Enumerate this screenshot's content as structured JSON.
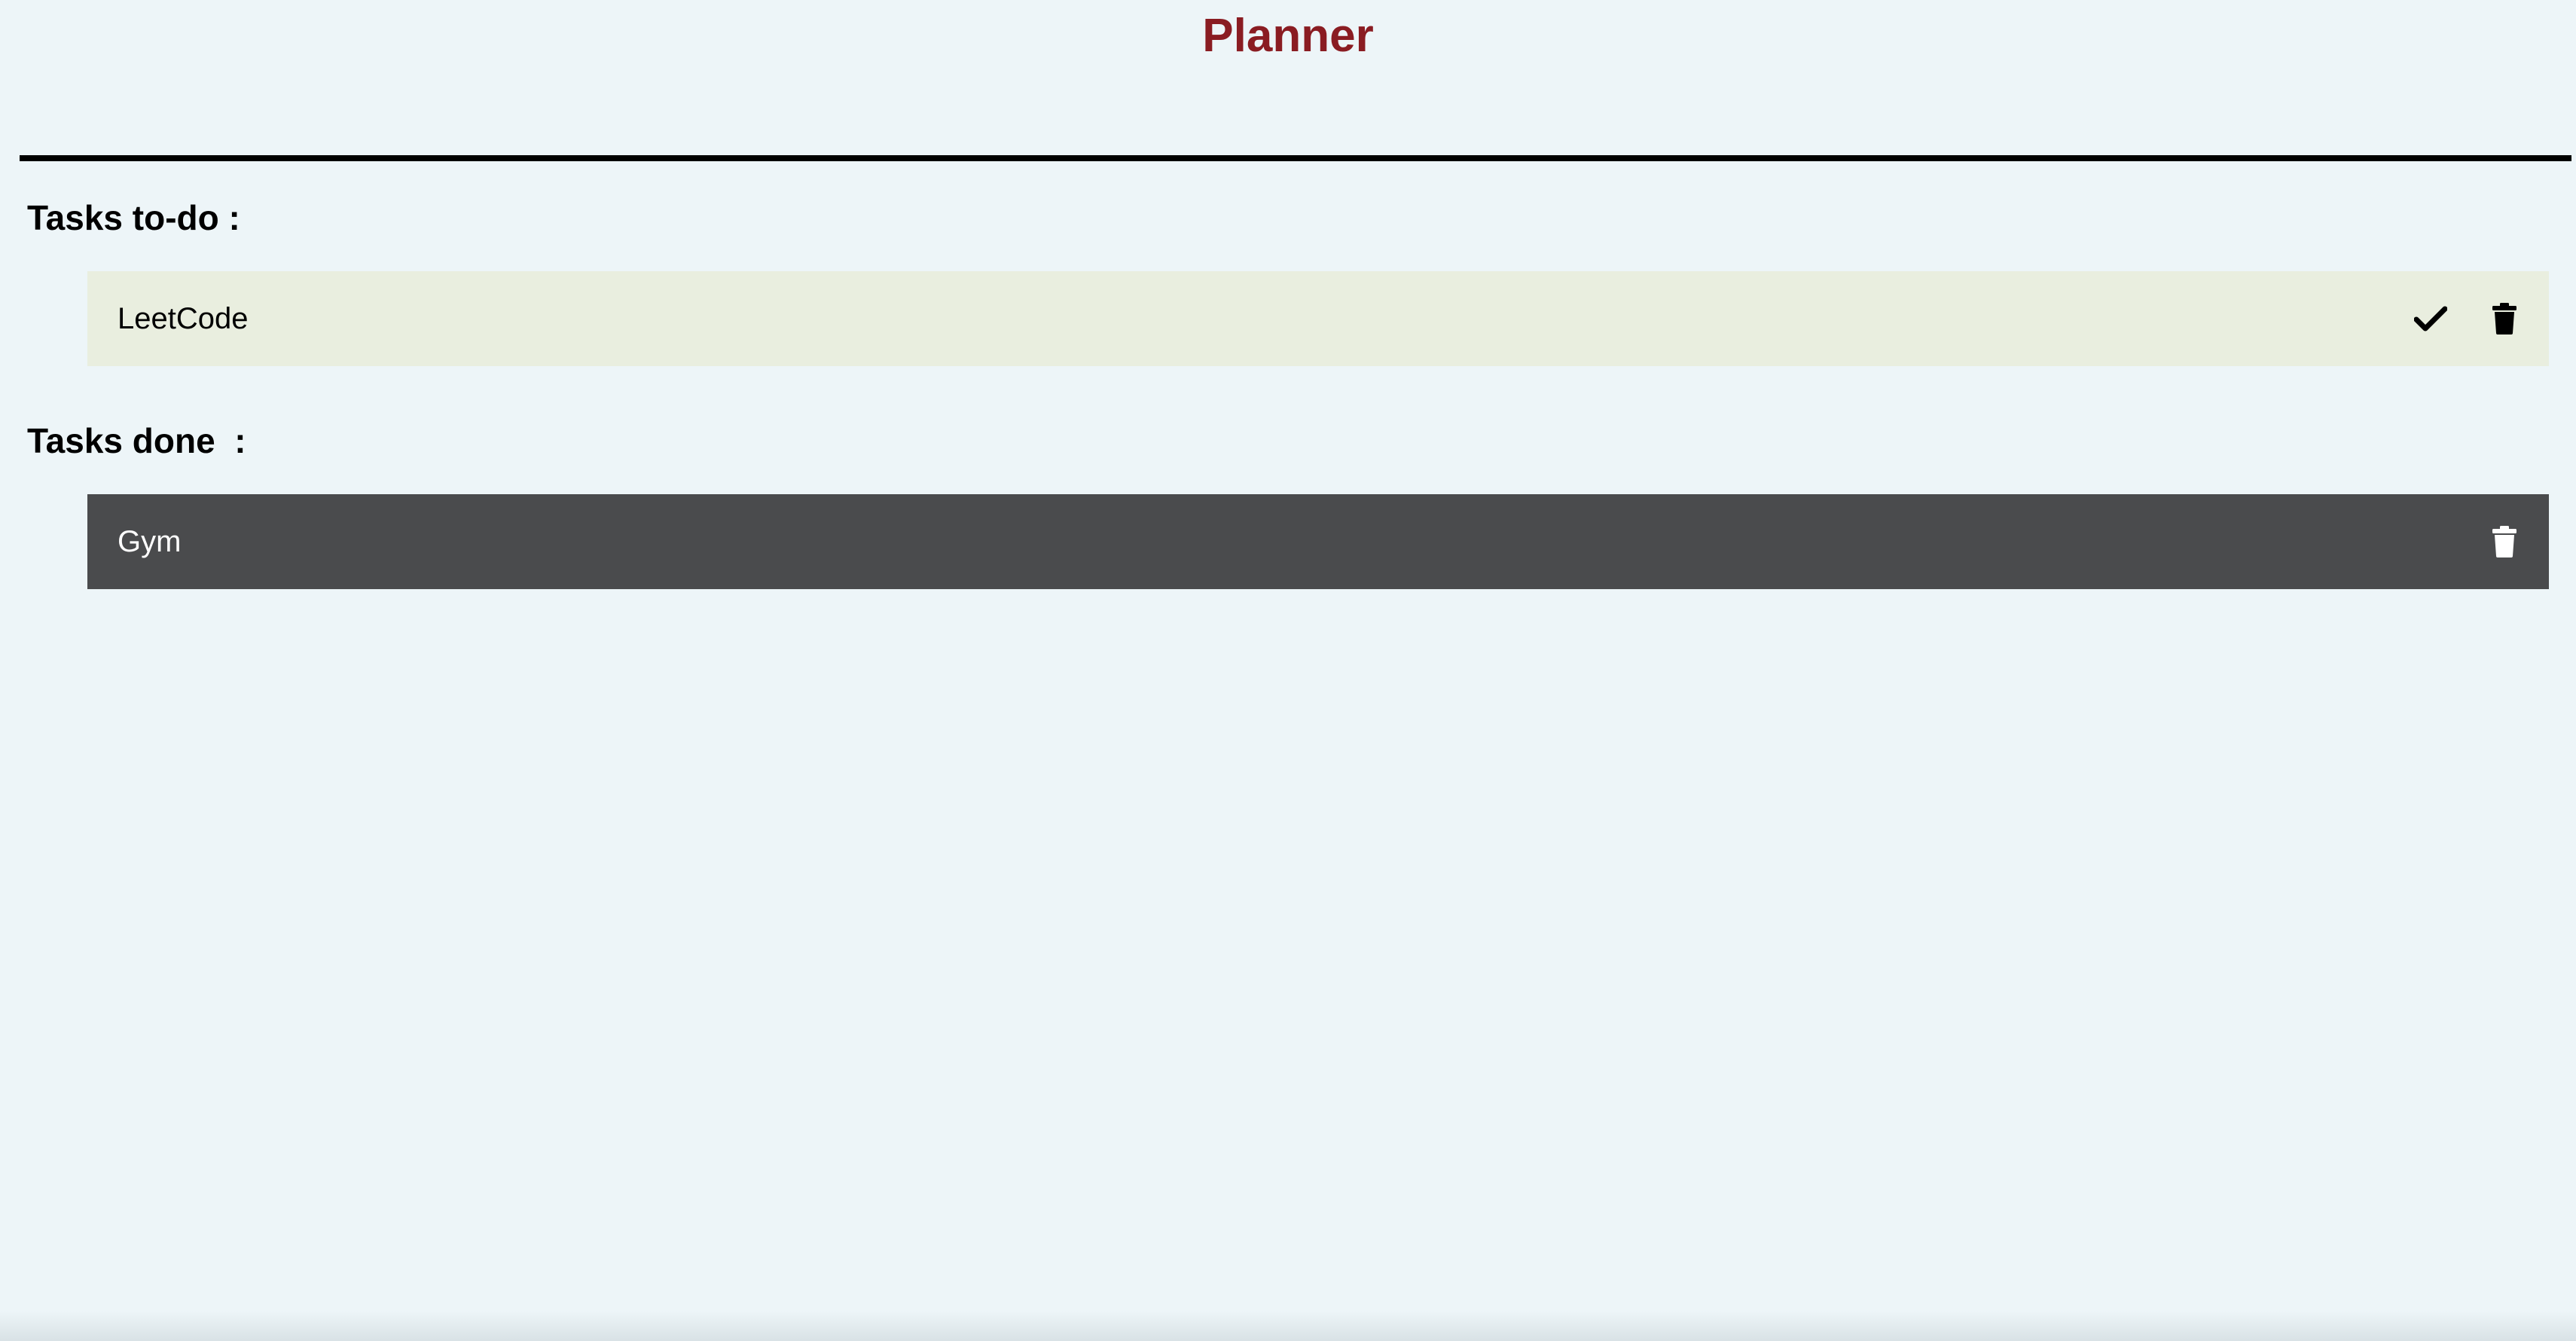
{
  "app": {
    "title": "Planner"
  },
  "sections": {
    "todo": {
      "heading": "Tasks to-do :",
      "items": [
        {
          "label": "LeetCode",
          "complete_icon": "check-icon",
          "delete_icon": "trash-icon"
        }
      ]
    },
    "done": {
      "heading": "Tasks done  :",
      "items": [
        {
          "label": "Gym",
          "delete_icon": "trash-icon"
        }
      ]
    }
  },
  "colors": {
    "background": "#edf5f8",
    "title": "#8a1c22",
    "todo_row": "#e9eedf",
    "done_row": "#4a4b4d",
    "divider": "#000000"
  }
}
